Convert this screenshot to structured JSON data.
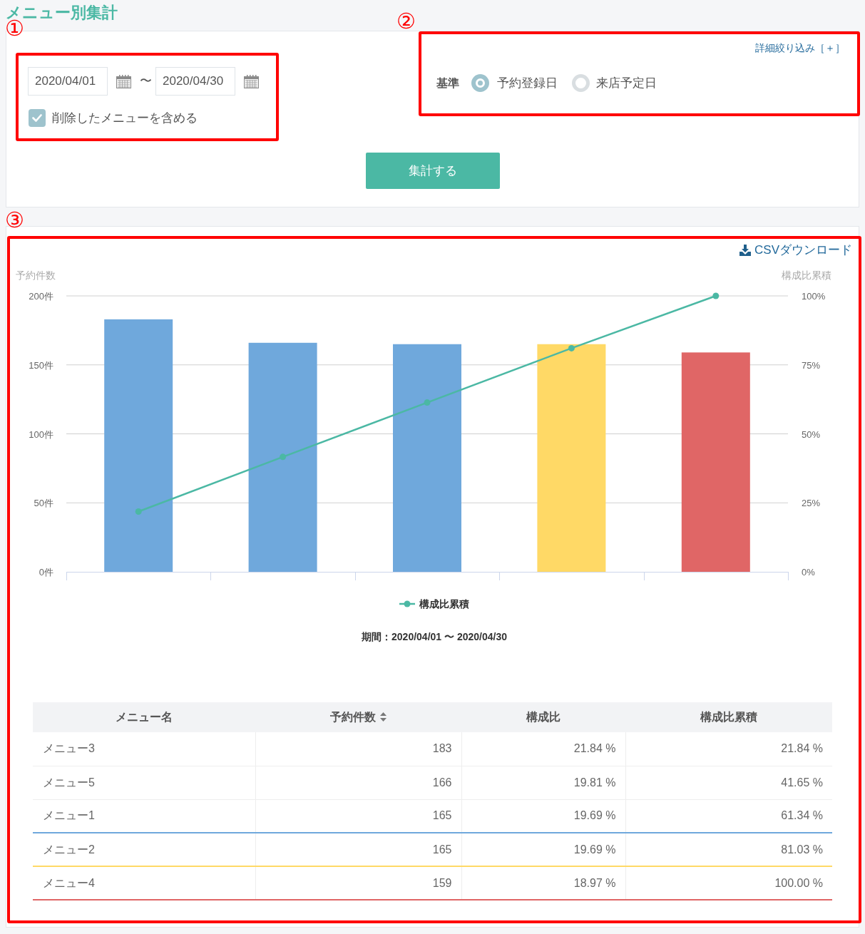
{
  "page_title": "メニュー別集計",
  "conditions": {
    "period_group": {
      "callout": "①",
      "date_from": {
        "value": "2020/04/01"
      },
      "separator": "〜",
      "date_to": {
        "value": "2020/04/30"
      },
      "include_deleted": {
        "label": "削除したメニューを含める",
        "checked": true
      }
    },
    "basis_group": {
      "callout": "②",
      "filter_link": "詳細絞り込み［＋］",
      "label": "基準",
      "options": [
        {
          "label": "予約登録日",
          "selected": true
        },
        {
          "label": "来店予定日",
          "selected": false
        }
      ]
    },
    "submit_button": "集計する"
  },
  "report": {
    "callout": "③",
    "csv_link": "CSVダウンロード",
    "chart_data": {
      "type": "bar",
      "grid": true,
      "ylabel": "予約件数",
      "ylim": [
        0,
        200
      ],
      "yticks": [
        {
          "value": 0,
          "label": "0件"
        },
        {
          "value": 50,
          "label": "50件"
        },
        {
          "value": 100,
          "label": "100件"
        },
        {
          "value": 150,
          "label": "150件"
        },
        {
          "value": 200,
          "label": "200件"
        }
      ],
      "y2label": "構成比累積",
      "y2lim": [
        0,
        100
      ],
      "y2ticks": [
        {
          "value": 0,
          "label": "0%"
        },
        {
          "value": 25,
          "label": "25%"
        },
        {
          "value": 50,
          "label": "50%"
        },
        {
          "value": 75,
          "label": "75%"
        },
        {
          "value": 100,
          "label": "100%"
        }
      ],
      "series": [
        {
          "colors": [
            "#6fa8dc",
            "#6fa8dc",
            "#6fa8dc",
            "#ffd966",
            "#e06666"
          ],
          "values": [
            183,
            166,
            165,
            165,
            159
          ]
        },
        {
          "type": "line",
          "axis": "y2",
          "marker": "circle",
          "name": "構成比累積",
          "color": "#4bb8a4",
          "values": [
            21.84,
            41.65,
            61.34,
            81.03,
            100
          ]
        }
      ]
    },
    "period": "期間：2020/04/01 〜 2020/04/30",
    "table": {
      "columns": [
        {
          "label": "メニュー名",
          "sortable": false
        },
        {
          "label": "予約件数",
          "sortable": true
        },
        {
          "label": "構成比",
          "sortable": false
        },
        {
          "label": "構成比累積",
          "sortable": false
        }
      ],
      "rows": [
        {
          "cells": [
            "メニュー3",
            "183",
            "21.84 %",
            "21.84 %"
          ]
        },
        {
          "cells": [
            "メニュー5",
            "166",
            "19.81 %",
            "41.65 %"
          ]
        },
        {
          "cells": [
            "メニュー1",
            "165",
            "19.69 %",
            "61.34 %"
          ]
        },
        {
          "cells": [
            "メニュー2",
            "165",
            "19.69 %",
            "81.03 %"
          ]
        },
        {
          "cells": [
            "メニュー4",
            "159",
            "18.97 %",
            "100.00 %"
          ]
        }
      ]
    }
  }
}
